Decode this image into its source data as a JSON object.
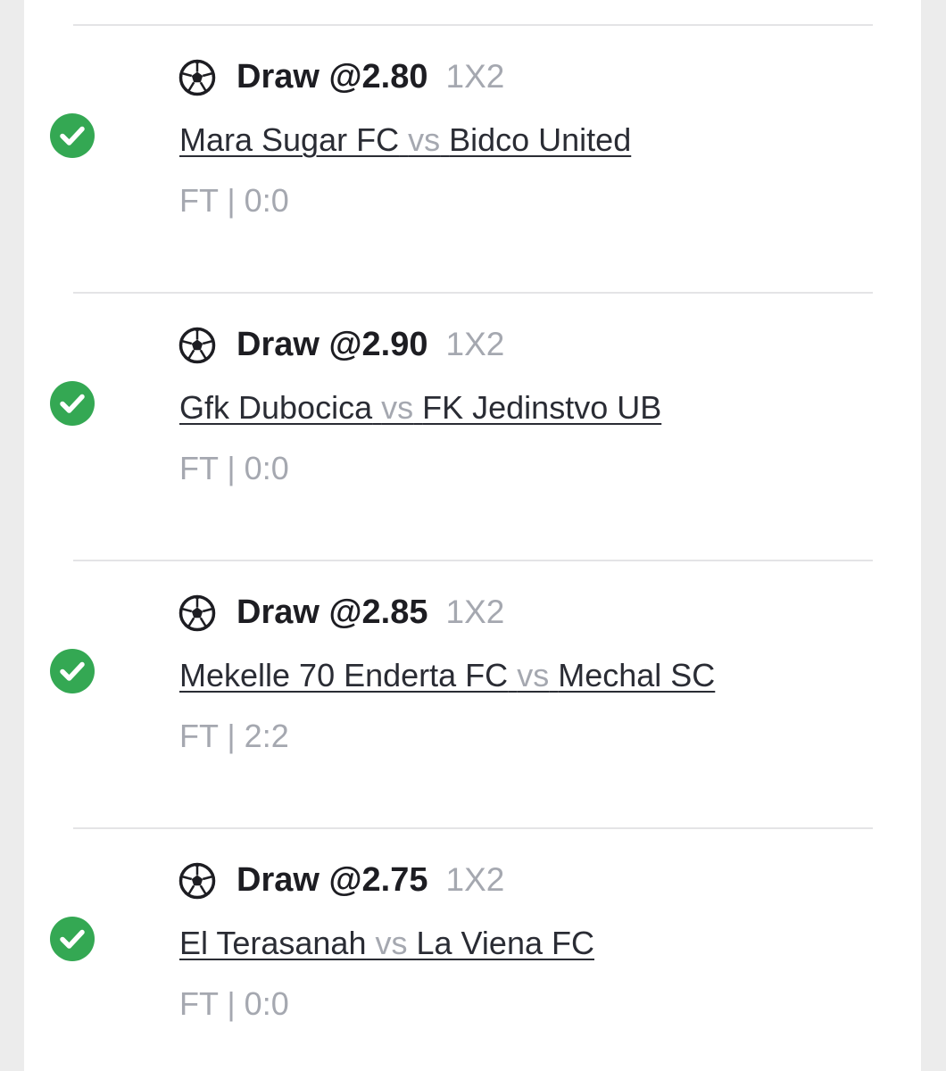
{
  "colors": {
    "success": "#34a853",
    "muted_text": "#a5a8b0",
    "primary_text": "#1d1d22"
  },
  "bets": [
    {
      "status_icon": "check-circle-icon",
      "sport_icon": "soccer-ball-icon",
      "pick": "Draw @2.80",
      "market": "1X2",
      "home": "Mara Sugar FC",
      "vs": "vs",
      "away": "Bidco United",
      "result": "FT | 0:0"
    },
    {
      "status_icon": "check-circle-icon",
      "sport_icon": "soccer-ball-icon",
      "pick": "Draw @2.90",
      "market": "1X2",
      "home": "Gfk Dubocica",
      "vs": "vs",
      "away": "FK Jedinstvo UB",
      "result": "FT | 0:0"
    },
    {
      "status_icon": "check-circle-icon",
      "sport_icon": "soccer-ball-icon",
      "pick": "Draw @2.85",
      "market": "1X2",
      "home": "Mekelle 70 Enderta FC",
      "vs": "vs",
      "away": "Mechal SC",
      "result": "FT | 2:2"
    },
    {
      "status_icon": "check-circle-icon",
      "sport_icon": "soccer-ball-icon",
      "pick": "Draw @2.75",
      "market": "1X2",
      "home": "El Terasanah",
      "vs": "vs",
      "away": "La Viena FC",
      "result": "FT | 0:0"
    }
  ]
}
